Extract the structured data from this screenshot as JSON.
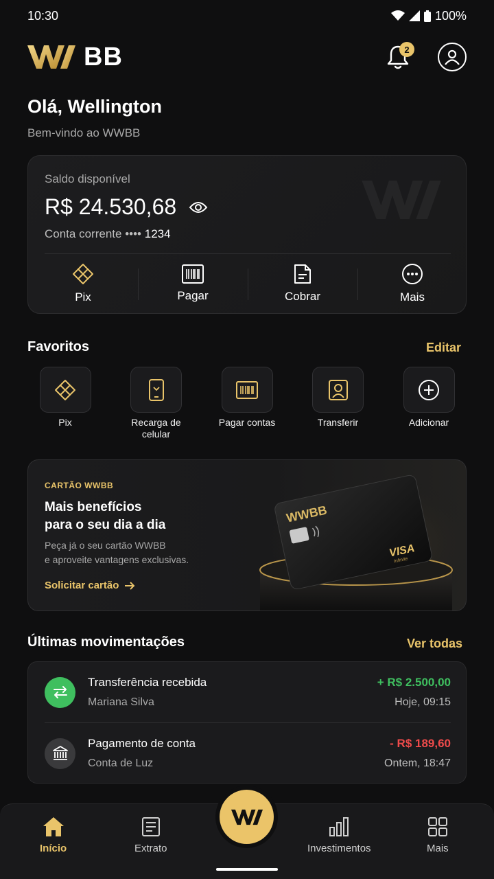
{
  "status_bar": {
    "time": "10:30",
    "battery": "100%"
  },
  "header": {
    "logo_mark": "WW",
    "logo_text": "BB",
    "notifications_count": "2"
  },
  "greeting": {
    "title": "Olá, Wellington",
    "subtitle": "Bem-vindo ao WWBB"
  },
  "balance": {
    "label": "Saldo disponível",
    "value": "R$ 24.530,68",
    "account_label": "Conta corrente",
    "account_mask": "••••",
    "account_number": "1234",
    "actions": [
      "Pix",
      "Pagar",
      "Cobrar",
      "Mais"
    ]
  },
  "favorites": {
    "title": "Favoritos",
    "edit_label": "Editar",
    "items": [
      {
        "label": "Pix",
        "icon": "pix-icon"
      },
      {
        "label": "Recarga de celular",
        "icon": "phone-icon"
      },
      {
        "label": "Pagar contas",
        "icon": "barcode-icon"
      },
      {
        "label": "Transferir",
        "icon": "transfer-user-icon"
      },
      {
        "label": "Adicionar",
        "icon": "plus-icon"
      }
    ]
  },
  "promo": {
    "tag": "CARTÃO WWBB",
    "title_line1": "Mais benefícios",
    "title_line2": "para o seu dia a dia",
    "desc_line1": "Peça já o seu cartão WWBB",
    "desc_line2": "e aproveite vantagens exclusivas.",
    "cta": "Solicitar cartão",
    "card_brand": "WWBB",
    "card_network": "VISA",
    "card_network_sub": "Infinite"
  },
  "transactions": {
    "title": "Últimas movimentações",
    "see_all": "Ver todas",
    "items": [
      {
        "title": "Transferência recebida",
        "subtitle": "Mariana Silva",
        "amount": "+ R$ 2.500,00",
        "time": "Hoje, 09:15",
        "color": "#3fbf5f"
      },
      {
        "title": "Pagamento de conta",
        "subtitle": "Conta de Luz",
        "amount": "- R$ 189,60",
        "time": "Ontem, 18:47",
        "color": "#ef4b4b"
      }
    ]
  },
  "nav": {
    "items": [
      "Início",
      "Extrato",
      "Investimentos",
      "Mais"
    ],
    "center_label": "WW"
  },
  "colors": {
    "accent": "#e9c46a",
    "background": "#0f0f10",
    "income": "#3fbf5f",
    "expense": "#ef4b4b"
  }
}
